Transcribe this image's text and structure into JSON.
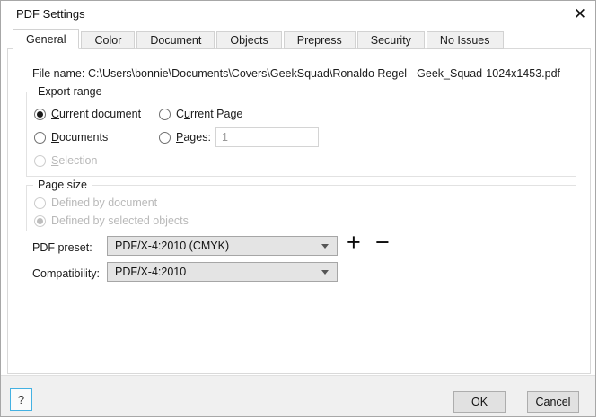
{
  "window": {
    "title": "PDF Settings",
    "close_glyph": "✕"
  },
  "tabs": [
    {
      "label": "General",
      "active": true
    },
    {
      "label": "Color",
      "active": false
    },
    {
      "label": "Document",
      "active": false
    },
    {
      "label": "Objects",
      "active": false
    },
    {
      "label": "Prepress",
      "active": false
    },
    {
      "label": "Security",
      "active": false
    },
    {
      "label": "No Issues",
      "active": false
    }
  ],
  "file": {
    "label": "File name:",
    "path": "C:\\Users\\bonnie\\Documents\\Covers\\GeekSquad\\Ronaldo Regel - Geek_Squad-1024x1453.pdf"
  },
  "export_range": {
    "legend": "Export range",
    "current_document": {
      "pre": "",
      "key": "C",
      "post": "urrent document",
      "checked": true
    },
    "current_page": {
      "pre": "C",
      "key": "u",
      "post": "rrent Page",
      "checked": false
    },
    "documents": {
      "pre": "",
      "key": "D",
      "post": "ocuments",
      "checked": false
    },
    "pages": {
      "pre": "",
      "key": "P",
      "post": "ages:",
      "checked": false
    },
    "selection": {
      "pre": "",
      "key": "S",
      "post": "election",
      "checked": false,
      "disabled": true
    },
    "pages_value": "1"
  },
  "page_size": {
    "legend": "Page size",
    "defined_by_document": {
      "label": "Defined by document",
      "checked": false,
      "disabled": true
    },
    "defined_by_selected_objects": {
      "label": "Defined by selected objects",
      "checked": true,
      "disabled": true
    }
  },
  "pdf_preset": {
    "label": "PDF preset:",
    "value": "PDF/X-4:2010 (CMYK)",
    "add_glyph": "+",
    "remove_glyph": "−"
  },
  "compatibility": {
    "label": "Compatibility:",
    "value": "PDF/X-4:2010"
  },
  "footer": {
    "help": "?",
    "ok": "OK",
    "cancel": "Cancel"
  },
  "colors": {
    "dialog_bg": "#ffffff",
    "footer_bg": "#f0f0f0",
    "tab_inactive_bg": "#f0f0f0",
    "combo_bg": "#e4e4e4",
    "button_bg": "#e1e1e1",
    "button_border": "#adadad",
    "help_focus_border": "#44b1e2",
    "disabled_text": "#b9b9b9"
  }
}
